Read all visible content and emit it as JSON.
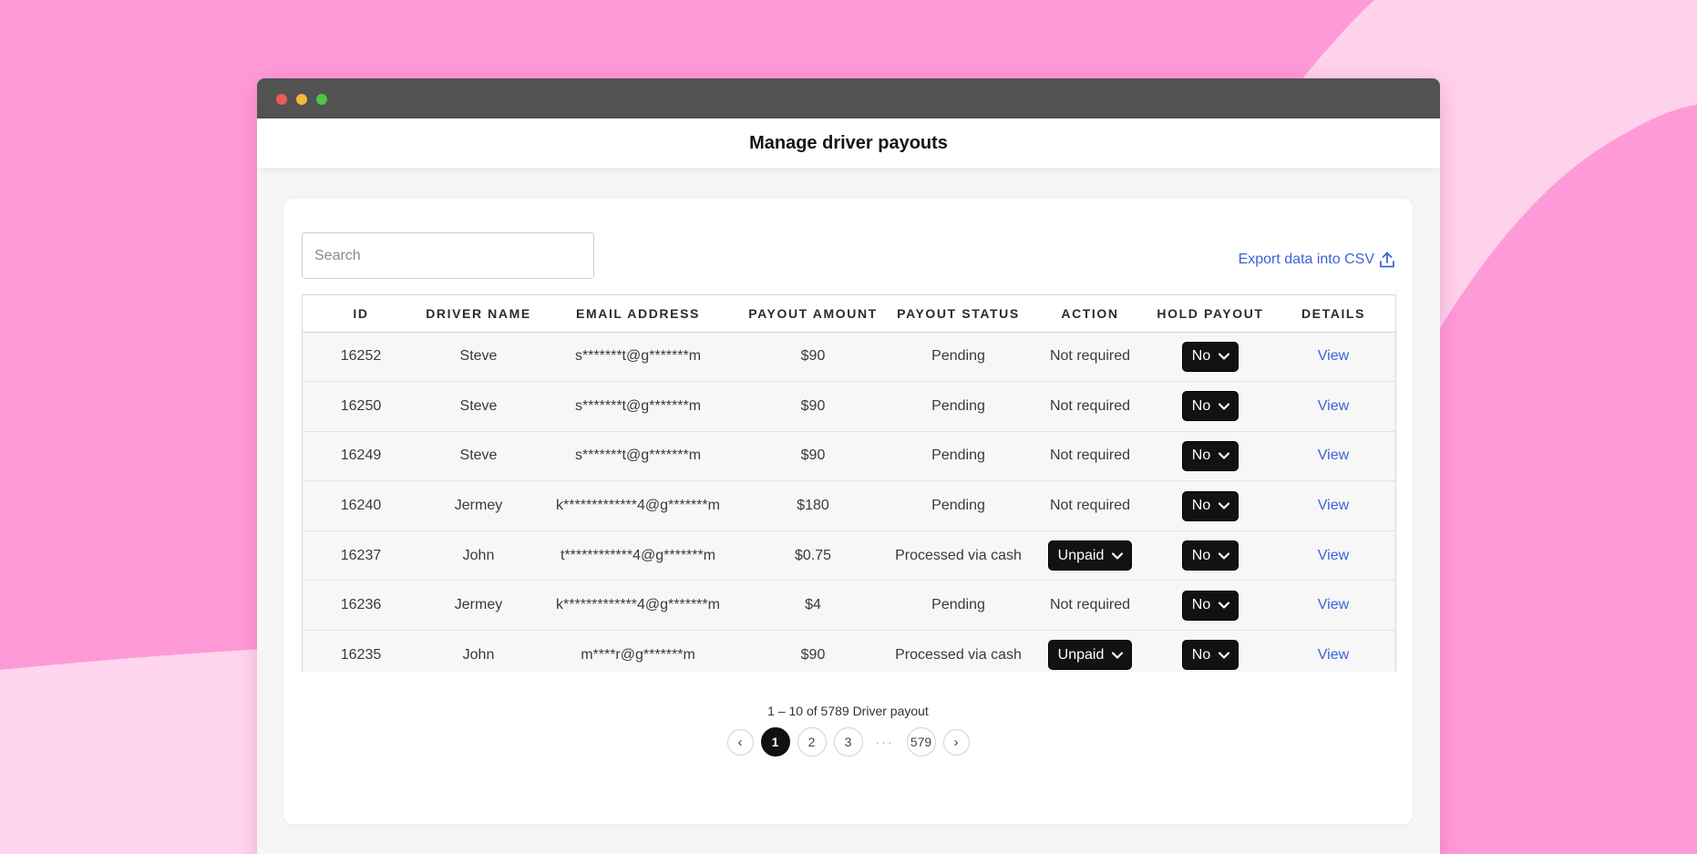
{
  "app": {
    "page_title": "Manage driver payouts"
  },
  "toolbar": {
    "search_placeholder": "Search",
    "search_value": "",
    "export_label": "Export data into CSV"
  },
  "table": {
    "columns": [
      "ID",
      "DRIVER NAME",
      "EMAIL ADDRESS",
      "PAYOUT AMOUNT",
      "PAYOUT STATUS",
      "ACTION",
      "HOLD PAYOUT",
      "DETAILS"
    ],
    "rows": [
      {
        "id": "16252",
        "name": "Steve",
        "email": "s*******t@g*******m",
        "amount": "$90",
        "status": "Pending",
        "action": "Not required",
        "hold": "No",
        "details": "View"
      },
      {
        "id": "16250",
        "name": "Steve",
        "email": "s*******t@g*******m",
        "amount": "$90",
        "status": "Pending",
        "action": "Not required",
        "hold": "No",
        "details": "View"
      },
      {
        "id": "16249",
        "name": "Steve",
        "email": "s*******t@g*******m",
        "amount": "$90",
        "status": "Pending",
        "action": "Not required",
        "hold": "No",
        "details": "View"
      },
      {
        "id": "16240",
        "name": "Jermey",
        "email": "k*************4@g*******m",
        "amount": "$180",
        "status": "Pending",
        "action": "Not required",
        "hold": "No",
        "details": "View"
      },
      {
        "id": "16237",
        "name": "John",
        "email": "t************4@g*******m",
        "amount": "$0.75",
        "status": "Processed via cash",
        "action": "Unpaid",
        "hold": "No",
        "details": "View"
      },
      {
        "id": "16236",
        "name": "Jermey",
        "email": "k*************4@g*******m",
        "amount": "$4",
        "status": "Pending",
        "action": "Not required",
        "hold": "No",
        "details": "View"
      },
      {
        "id": "16235",
        "name": "John",
        "email": "m****r@g*******m",
        "amount": "$90",
        "status": "Processed via cash",
        "action": "Unpaid",
        "hold": "No",
        "details": "View"
      }
    ]
  },
  "pagination": {
    "summary": "1 – 10 of 5789 Driver payout",
    "prev": "‹",
    "next": "›",
    "pages": [
      "1",
      "2",
      "3"
    ],
    "ellipsis": "···",
    "last_page": "579",
    "current_page": "1"
  },
  "colors": {
    "background": "#ff9ad8",
    "titlebar": "#525252",
    "link": "#3b63d6",
    "pill": "#121212"
  }
}
